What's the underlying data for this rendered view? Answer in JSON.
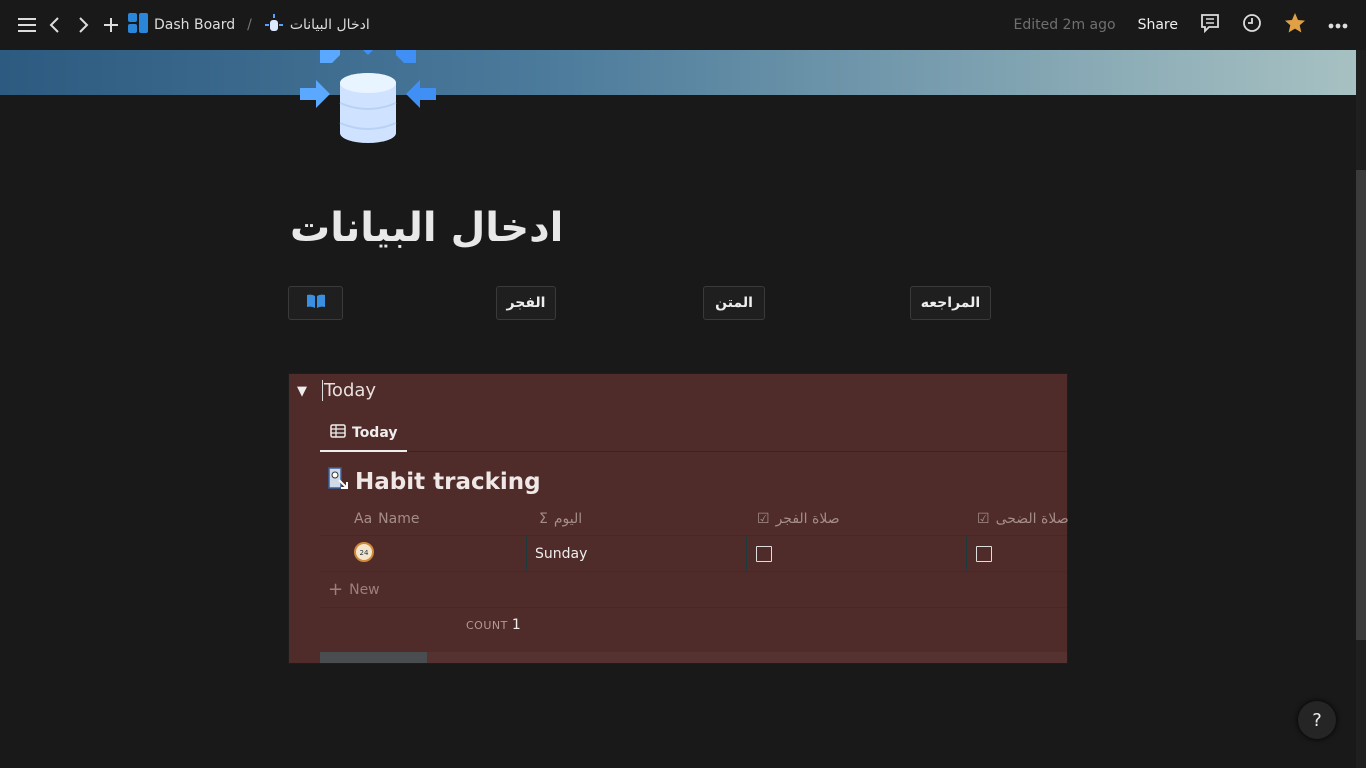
{
  "topbar": {
    "workspace": "Dash Board",
    "separator": "/",
    "page": "ادخال البيانات",
    "edited": "Edited 2m ago",
    "share": "Share"
  },
  "page": {
    "title": "ادخال البيانات"
  },
  "buttons": [
    {
      "label": "",
      "icon": "book-icon"
    },
    {
      "label": "الفجر"
    },
    {
      "label": "المتن"
    },
    {
      "label": "المراجعه"
    }
  ],
  "toggle": {
    "title": "Today",
    "view_tab": "Today",
    "database_title": "Habit tracking",
    "columns": [
      {
        "icon": "Aa",
        "label": "Name"
      },
      {
        "icon": "Σ",
        "label": "اليوم"
      },
      {
        "icon": "☑",
        "label": "صلاة الفجر"
      },
      {
        "icon": "☑",
        "label": "صلاة الضحى"
      }
    ],
    "rows": [
      {
        "name_icon": "24h-clock-icon",
        "day": "Sunday",
        "fajr": false,
        "duha": false
      }
    ],
    "new_label": "New",
    "count_label": "COUNT",
    "count_value": "1"
  },
  "help": "?",
  "colors": {
    "accent_star": "#e0a045",
    "toggle_bg": "#4f2b29"
  }
}
